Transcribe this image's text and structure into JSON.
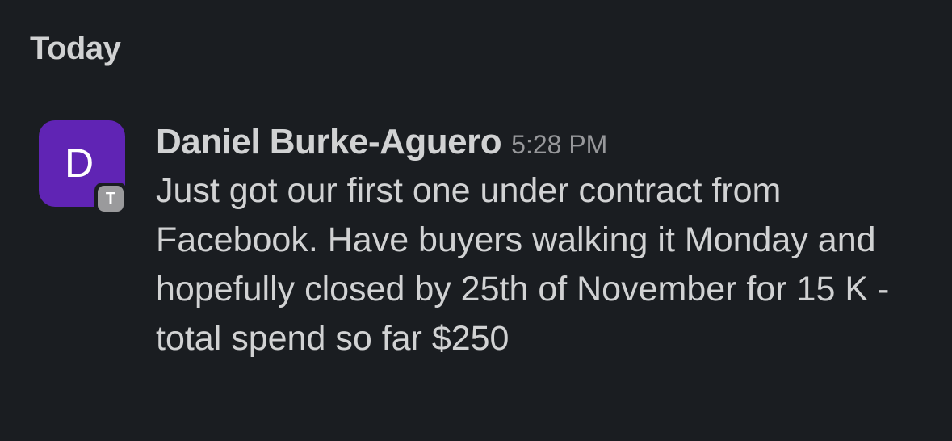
{
  "day_header": "Today",
  "message": {
    "avatar": {
      "letter": "D",
      "badge_letter": "T",
      "color": "#6024b4"
    },
    "author": "Daniel Burke-Aguero",
    "timestamp": "5:28 PM",
    "text": "Just got our first one under contract from Facebook. Have buyers walking it Monday and hopefully closed by 25th of November for 15 K - total spend so far $250"
  }
}
